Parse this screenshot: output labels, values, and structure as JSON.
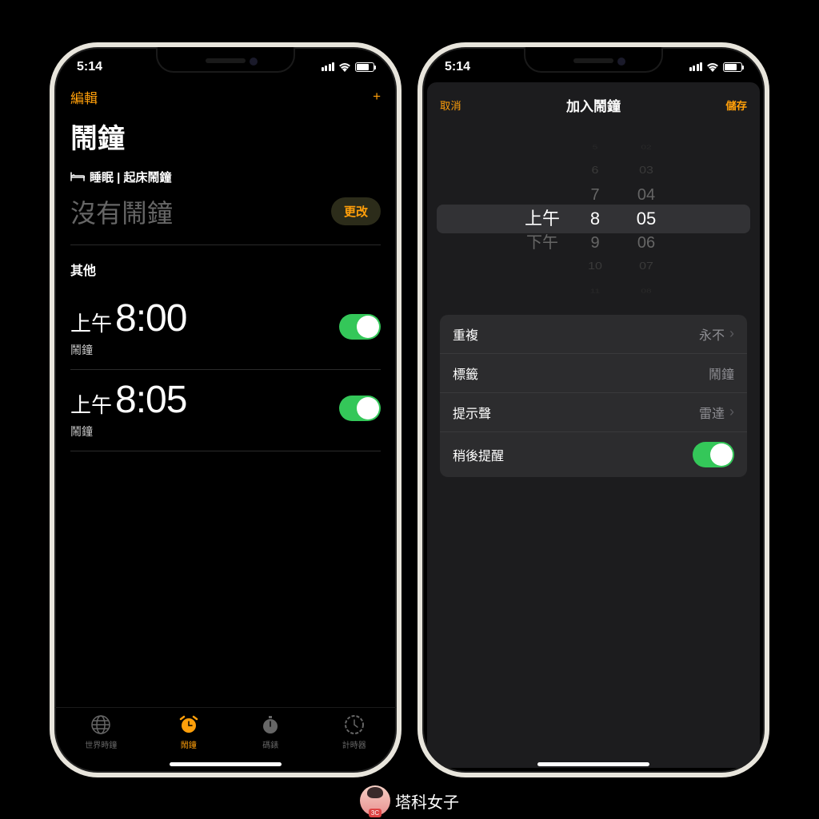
{
  "status": {
    "time": "5:14"
  },
  "alarm_screen": {
    "edit": "編輯",
    "title": "鬧鐘",
    "sleep_section": "睡眠 | 起床鬧鐘",
    "no_alarm": "沒有鬧鐘",
    "change": "更改",
    "other": "其他",
    "alarms": [
      {
        "ampm": "上午",
        "time": "8:00",
        "label": "鬧鐘"
      },
      {
        "ampm": "上午",
        "time": "8:05",
        "label": "鬧鐘"
      }
    ],
    "tabs": [
      {
        "label": "世界時鐘"
      },
      {
        "label": "鬧鐘"
      },
      {
        "label": "碼錶"
      },
      {
        "label": "計時器"
      }
    ]
  },
  "add_screen": {
    "cancel": "取消",
    "title": "加入鬧鐘",
    "save": "儲存",
    "picker": {
      "ampm_sel": "上午",
      "ampm_other": "下午",
      "hour_sel": "8",
      "hours_above": [
        "5",
        "6",
        "7"
      ],
      "hours_below": [
        "9",
        "10",
        "11"
      ],
      "min_sel": "05",
      "mins_above": [
        "02",
        "03",
        "04"
      ],
      "mins_below": [
        "06",
        "07",
        "08"
      ]
    },
    "rows": {
      "repeat": "重複",
      "repeat_val": "永不",
      "label": "標籤",
      "label_val": "鬧鐘",
      "sound": "提示聲",
      "sound_val": "雷達",
      "snooze": "稍後提醒"
    }
  },
  "watermark": {
    "text": "塔科女子",
    "badge": "3C"
  }
}
